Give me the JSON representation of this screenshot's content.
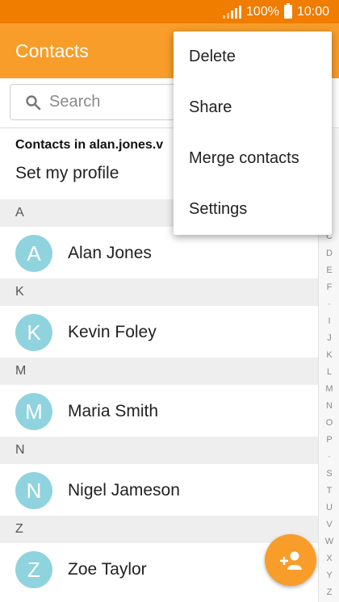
{
  "status_bar": {
    "battery_text": "100%",
    "time": "10:00",
    "icons": [
      "signal-icon",
      "battery-icon"
    ]
  },
  "app_bar": {
    "title": "Contacts",
    "color": "#f89d2a",
    "status_color": "#f07c00"
  },
  "search": {
    "placeholder": "Search",
    "icon": "search-icon"
  },
  "account_label": "Contacts in alan.jones.v",
  "set_profile": "Set my profile",
  "sections": [
    {
      "letter": "A",
      "contacts": [
        {
          "initial": "A",
          "name": "Alan Jones"
        }
      ]
    },
    {
      "letter": "K",
      "contacts": [
        {
          "initial": "K",
          "name": "Kevin Foley"
        }
      ]
    },
    {
      "letter": "M",
      "contacts": [
        {
          "initial": "M",
          "name": "Maria Smith"
        }
      ]
    },
    {
      "letter": "N",
      "contacts": [
        {
          "initial": "N",
          "name": "Nigel Jameson"
        }
      ]
    },
    {
      "letter": "Z",
      "contacts": [
        {
          "initial": "Z",
          "name": "Zoe Taylor"
        }
      ]
    }
  ],
  "index_letters": [
    "C",
    "D",
    "E",
    "F",
    "·",
    "I",
    "J",
    "K",
    "L",
    "M",
    "N",
    "O",
    "P",
    "·",
    "S",
    "T",
    "U",
    "V",
    "W",
    "X",
    "Y",
    "Z"
  ],
  "menu": {
    "items": [
      "Delete",
      "Share",
      "Merge contacts",
      "Settings"
    ]
  },
  "fab": {
    "icon": "add-contact-icon"
  },
  "colors": {
    "accent": "#f89d2a",
    "avatar": "#8fd3de"
  }
}
